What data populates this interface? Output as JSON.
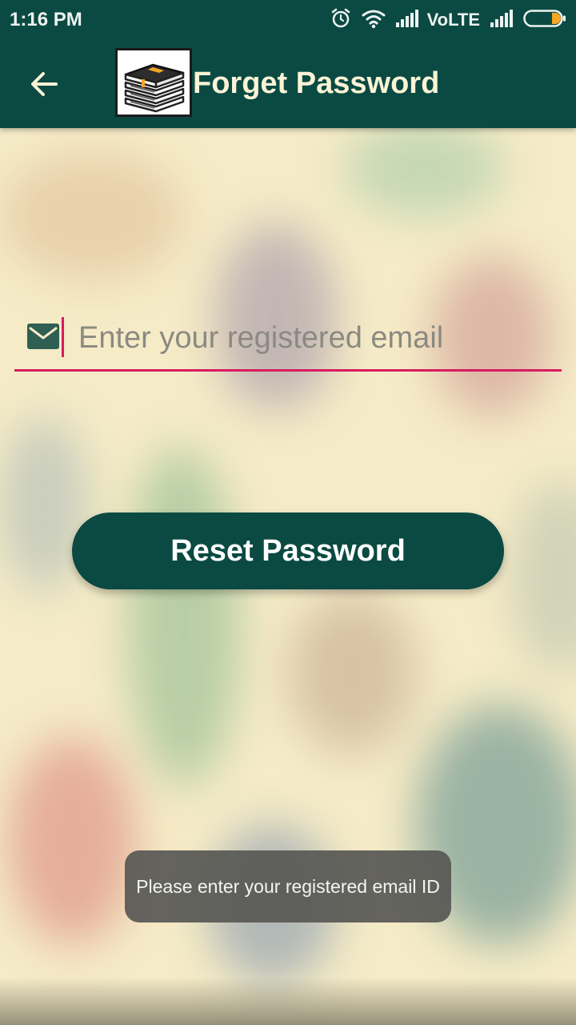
{
  "status_bar": {
    "time": "1:16 PM",
    "network_label": "VoLTE",
    "icons": [
      "alarm-icon",
      "wifi-icon",
      "signal-icon",
      "signal-icon",
      "battery-icon"
    ],
    "battery_accent": "#f5a623"
  },
  "toolbar": {
    "back_icon": "arrow-back-icon",
    "logo": "books-logo",
    "title": "Forget Password"
  },
  "form": {
    "email_icon": "email-icon",
    "email_value": "",
    "email_placeholder": "Enter your registered email",
    "reset_button_label": "Reset Password"
  },
  "toast": {
    "message": "Please enter your registered email ID"
  },
  "colors": {
    "primary": "#0a4a42",
    "accent": "#d81b60",
    "title_text": "#fbf3d6",
    "background": "#f5ebc6"
  }
}
